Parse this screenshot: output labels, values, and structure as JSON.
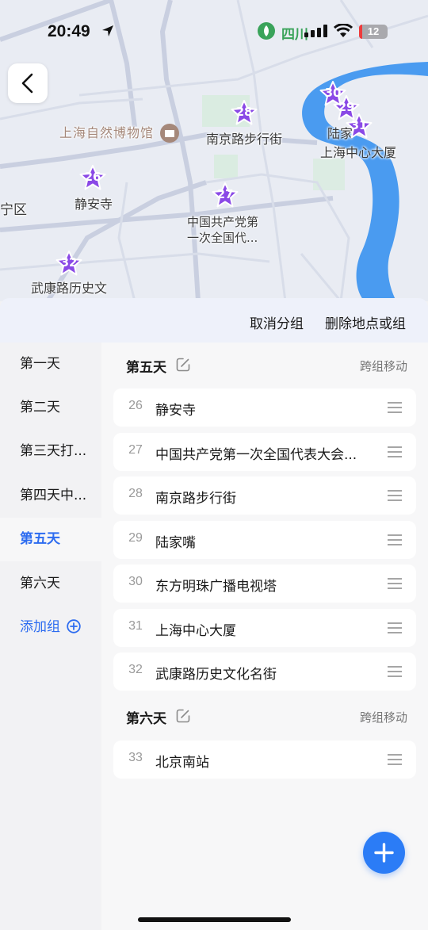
{
  "status_bar": {
    "time": "20:49",
    "route_label": "四川",
    "battery": "12",
    "icons": [
      "location-arrow-icon",
      "route-pill-icon",
      "signal-icon",
      "wifi-icon",
      "battery-icon"
    ]
  },
  "map": {
    "back_icon": "chevron-left-icon",
    "labels": {
      "museum": "上海自然博物馆",
      "nanjing_road": "南京路步行街",
      "jingan_temple": "静安寺",
      "cpc_site": "中国共产党第\n一次全国代...",
      "lujiazui": "陆家",
      "shanghai_center": "上海中心大厦",
      "wukang_road": "武康路历史文",
      "district": "宁区"
    },
    "markers": [
      "26",
      "27",
      "28",
      "29",
      "30",
      "31",
      "32"
    ],
    "colors": {
      "water": "#4a9bf0",
      "marker": "#8a49e6",
      "map_bg": "#e9ecf3"
    }
  },
  "actions": {
    "cancel_group": "取消分组",
    "delete_place_or_group": "删除地点或组"
  },
  "sidebar": {
    "days": [
      {
        "label": "第一天",
        "active": false
      },
      {
        "label": "第二天",
        "active": false
      },
      {
        "label": "第三天打...",
        "active": false
      },
      {
        "label": "第四天中...",
        "active": false
      },
      {
        "label": "第五天",
        "active": true
      },
      {
        "label": "第六天",
        "active": false
      }
    ],
    "add_group": "添加组",
    "accent": "#2d6cf0"
  },
  "groups": [
    {
      "title": "第五天",
      "move_label": "跨组移动",
      "items": [
        {
          "num": "26",
          "name": "静安寺"
        },
        {
          "num": "27",
          "name": "中国共产党第一次全国代表大会..."
        },
        {
          "num": "28",
          "name": "南京路步行街"
        },
        {
          "num": "29",
          "name": "陆家嘴"
        },
        {
          "num": "30",
          "name": "东方明珠广播电视塔"
        },
        {
          "num": "31",
          "name": "上海中心大厦"
        },
        {
          "num": "32",
          "name": "武康路历史文化名街"
        }
      ]
    },
    {
      "title": "第六天",
      "move_label": "跨组移动",
      "items": [
        {
          "num": "33",
          "name": "北京南站"
        }
      ]
    }
  ],
  "fab_icon": "plus-icon"
}
